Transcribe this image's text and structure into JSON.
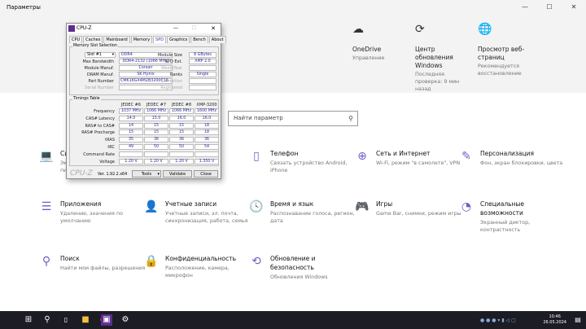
{
  "window": {
    "title": "Параметры",
    "minimize": "—",
    "maximize": "☐",
    "close": "✕"
  },
  "header": [
    {
      "icon": "cloud-icon",
      "glyph": "☁",
      "title": "OneDrive",
      "subtitle": "Управление"
    },
    {
      "icon": "update-icon",
      "glyph": "⟳",
      "title": "Центр обновления Windows",
      "subtitle": "Последняя проверка: 9 мин назад"
    },
    {
      "icon": "globe-icon",
      "glyph": "🌐",
      "title": "Просмотр веб-страниц",
      "subtitle": "Рекомендуется восстановление"
    }
  ],
  "search": {
    "placeholder": "Найти параметр",
    "icon": "search-icon"
  },
  "categories": [
    {
      "icon": "laptop-icon",
      "glyph": "💻",
      "title": "Система",
      "subtitle": "Экран, звук, уведомления, питание"
    },
    {
      "icon": "phone-icon",
      "glyph": "▯",
      "title": "Телефон",
      "subtitle": "Связать устройство Android, iPhone"
    },
    {
      "icon": "network-icon",
      "glyph": "⊕",
      "title": "Сеть и Интернет",
      "subtitle": "Wi-Fi, режим \"в самолете\", VPN"
    },
    {
      "icon": "personalization-icon",
      "glyph": "✎",
      "title": "Персонализация",
      "subtitle": "Фон, экран блокировки, цвета"
    },
    {
      "icon": "apps-icon",
      "glyph": "☰",
      "title": "Приложения",
      "subtitle": "Удаление, значения по умолчанию"
    },
    {
      "icon": "accounts-icon",
      "glyph": "👤",
      "title": "Учетные записи",
      "subtitle": "Учетные записи, эл. почта, синхронизация, работа, семья"
    },
    {
      "icon": "time-language-icon",
      "glyph": "🕓",
      "title": "Время и язык",
      "subtitle": "Распознавание голоса, регион, дата"
    },
    {
      "icon": "gaming-icon",
      "glyph": "🎮",
      "title": "Игры",
      "subtitle": "Game Bar, снимки, режим игры"
    },
    {
      "icon": "accessibility-icon",
      "glyph": "◔",
      "title": "Специальные возможности",
      "subtitle": "Экранный диктор, контрастность"
    },
    {
      "icon": "search-icon",
      "glyph": "⚲",
      "title": "Поиск",
      "subtitle": "Найти мои файлы, разрешения"
    },
    {
      "icon": "lock-icon",
      "glyph": "🔒",
      "title": "Конфиденциальность",
      "subtitle": "Расположение, камера, микрофон"
    },
    {
      "icon": "sync-icon",
      "glyph": "⟲",
      "title": "Обновление и безопасность",
      "subtitle": "Обновления Windows"
    }
  ],
  "cpuz": {
    "title": "CPU-Z",
    "tabs": [
      "CPU",
      "Caches",
      "Mainboard",
      "Memory",
      "SPD",
      "Graphics",
      "Bench",
      "About"
    ],
    "active_tab": "SPD",
    "slot_group": "Memory Slot Selection",
    "slot": "Slot #1",
    "type": "DDR4",
    "module_size_label": "Module Size",
    "module_size": "8 GBytes",
    "max_bw_label": "Max Bandwidth",
    "max_bw": "DDR4-2132 (1066 MHz)",
    "spd_ext_label": "SPD Ext.",
    "spd_ext": "XMP 2.0",
    "module_manuf_label": "Module Manuf.",
    "module_manuf": "Corsair",
    "week_year_label": "Week/Year",
    "dram_manuf_label": "DRAM Manuf.",
    "dram_manuf": "SK Hynix",
    "ranks_label": "Ranks",
    "ranks": "Single",
    "part_label": "Part Number",
    "part": "CMK16GX4M2B3200C16",
    "correction_label": "Correction",
    "serial_label": "Serial Number",
    "registered_label": "Registered",
    "timings_group": "Timings Table",
    "columns": [
      "JEDEC #6",
      "JEDEC #7",
      "JEDEC #8",
      "XMP-3200"
    ],
    "rows": [
      {
        "label": "Frequency",
        "values": [
          "1037 MHz",
          "1066 MHz",
          "1066 MHz",
          "1600 MHz"
        ]
      },
      {
        "label": "CAS# Latency",
        "values": [
          "14.0",
          "15.0",
          "16.0",
          "16.0"
        ]
      },
      {
        "label": "RAS# to CAS#",
        "values": [
          "14",
          "15",
          "15",
          "18"
        ]
      },
      {
        "label": "RAS# Precharge",
        "values": [
          "15",
          "15",
          "15",
          "18"
        ]
      },
      {
        "label": "tRAS",
        "values": [
          "35",
          "36",
          "36",
          "36"
        ]
      },
      {
        "label": "tRC",
        "values": [
          "49",
          "50",
          "50",
          "54"
        ]
      },
      {
        "label": "Command Rate",
        "values": [
          "",
          "",
          "",
          ""
        ]
      },
      {
        "label": "Voltage",
        "values": [
          "1.20 V",
          "1.20 V",
          "1.20 V",
          "1.350 V"
        ]
      }
    ],
    "brand": "CPU-Z",
    "version": "Ver. 1.92.2.x64",
    "tools": "Tools",
    "validate": "Validate",
    "close": "Close"
  },
  "taskbar": {
    "time": "10:46",
    "date": "26.05.2024"
  },
  "colors": {
    "accent": "#6b5fc7",
    "taskbar": "#1c1c24"
  }
}
